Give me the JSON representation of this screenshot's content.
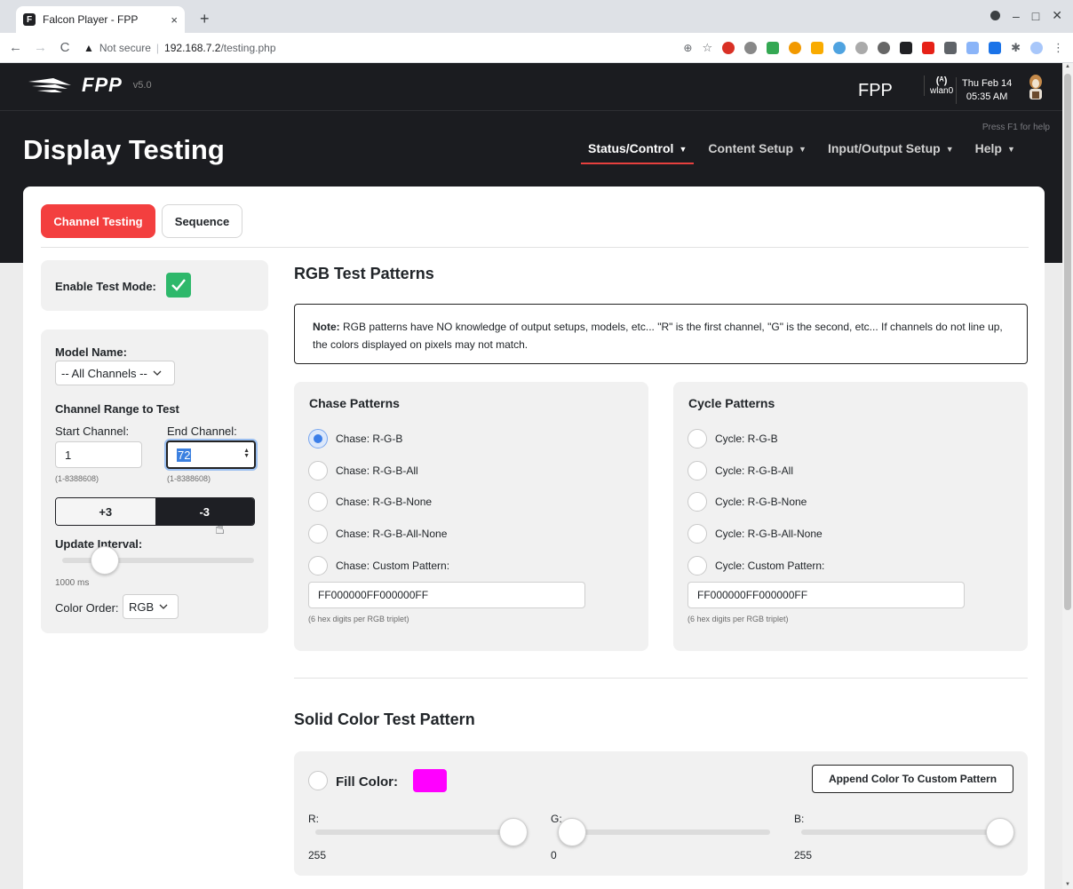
{
  "browser": {
    "tab_title": "Falcon Player - FPP",
    "tab_close": "×",
    "new_tab": "+",
    "security_warning": "Not secure",
    "url_host": "192.168.7.2",
    "url_path": "/testing.php"
  },
  "header": {
    "brand": "FPP",
    "version": "v5.0",
    "host_name": "FPP",
    "interface_icon": "(ᴬ)",
    "interface": "wlan0",
    "date": "Thu Feb 14",
    "time": "05:35 AM",
    "help_hint": "Press F1 for help",
    "page_title": "Display Testing",
    "nav": [
      {
        "label": "Status/Control"
      },
      {
        "label": "Content Setup"
      },
      {
        "label": "Input/Output Setup"
      },
      {
        "label": "Help"
      }
    ]
  },
  "tabs": {
    "channel_testing": "Channel Testing",
    "sequence": "Sequence"
  },
  "left_panel": {
    "enable_test_mode_label": "Enable Test Mode:",
    "model_name_label": "Model Name:",
    "model_name_value": "-- All Channels --",
    "channel_range_label": "Channel Range to Test",
    "start_channel_label": "Start Channel:",
    "end_channel_label": "End Channel:",
    "start_channel_value": "1",
    "end_channel_value": "72",
    "start_channel_range": "(1-8388608)",
    "end_channel_range": "(1-8388608)",
    "plus_label": "+3",
    "minus_label": "-3",
    "update_interval_label": "Update Interval:",
    "update_interval_value": "1000 ms",
    "update_interval_fraction": 0.22,
    "color_order_label": "Color Order:",
    "color_order_value": "RGB"
  },
  "rgb_section": {
    "title": "RGB Test Patterns",
    "note_bold": "Note:",
    "note_text": " RGB patterns have NO knowledge of output setups, models, etc... \"R\" is the first channel, \"G\" is the second, etc... If channels do not line up, the colors displayed on pixels may not match."
  },
  "chase": {
    "title": "Chase Patterns",
    "options": [
      "Chase: R-G-B",
      "Chase: R-G-B-All",
      "Chase: R-G-B-None",
      "Chase: R-G-B-All-None",
      "Chase: Custom Pattern:"
    ],
    "custom_value": "FF000000FF000000FF",
    "custom_hint": "(6 hex digits per RGB triplet)"
  },
  "cycle": {
    "title": "Cycle Patterns",
    "options": [
      "Cycle: R-G-B",
      "Cycle: R-G-B-All",
      "Cycle: R-G-B-None",
      "Cycle: R-G-B-All-None",
      "Cycle: Custom Pattern:"
    ],
    "custom_value": "FF000000FF000000FF",
    "custom_hint": "(6 hex digits per RGB triplet)"
  },
  "solid": {
    "title": "Solid Color Test Pattern",
    "fill_label": "Fill Color:",
    "fill_color": "#ff00ff",
    "append_label": "Append Color To Custom Pattern",
    "r_label": "R:",
    "g_label": "G:",
    "b_label": "B:",
    "r_value": "255",
    "g_value": "0",
    "b_value": "255"
  },
  "colors": {
    "accent_red": "#f33f3f",
    "header_bg": "#1b1c20",
    "check_green": "#2eb86b"
  }
}
